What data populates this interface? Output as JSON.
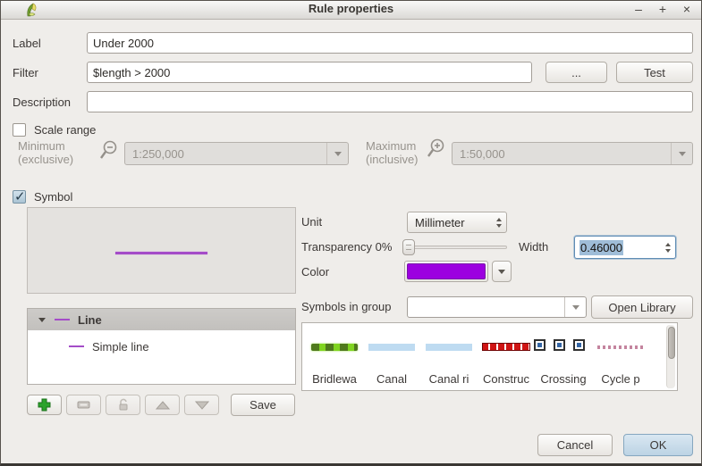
{
  "window": {
    "title": "Rule properties",
    "minimize": "–",
    "maximize": "+",
    "close": "×"
  },
  "fields": {
    "label": {
      "label": "Label",
      "value": "Under 2000"
    },
    "filter": {
      "label": "Filter",
      "value": "$length > 2000",
      "ellipsis_button": "...",
      "test_button": "Test"
    },
    "description": {
      "label": "Description",
      "value": ""
    }
  },
  "scale_range": {
    "label": "Scale range",
    "checked": false,
    "minimum": {
      "label_line1": "Minimum",
      "label_line2": "(exclusive)",
      "value": "1:250,000"
    },
    "maximum": {
      "label_line1": "Maximum",
      "label_line2": "(inclusive)",
      "value": "1:50,000"
    }
  },
  "symbol": {
    "label": "Symbol",
    "checked": true,
    "unit": {
      "label": "Unit",
      "value": "Millimeter"
    },
    "transparency": {
      "label": "Transparency 0%",
      "percent": 0
    },
    "width": {
      "label": "Width",
      "value": "0.46000"
    },
    "color": {
      "label": "Color",
      "hex": "#9c00e0"
    },
    "group": {
      "label": "Symbols in group",
      "value": "",
      "open_library_button": "Open Library"
    },
    "tree": {
      "root": "Line",
      "child": "Simple line"
    },
    "library": [
      {
        "name": "Bridlewa"
      },
      {
        "name": "Canal"
      },
      {
        "name": "Canal ri"
      },
      {
        "name": "Construc"
      },
      {
        "name": "Crossing"
      },
      {
        "name": "Cycle p"
      }
    ],
    "save_button": "Save"
  },
  "footer": {
    "cancel_button": "Cancel",
    "ok_button": "OK"
  }
}
